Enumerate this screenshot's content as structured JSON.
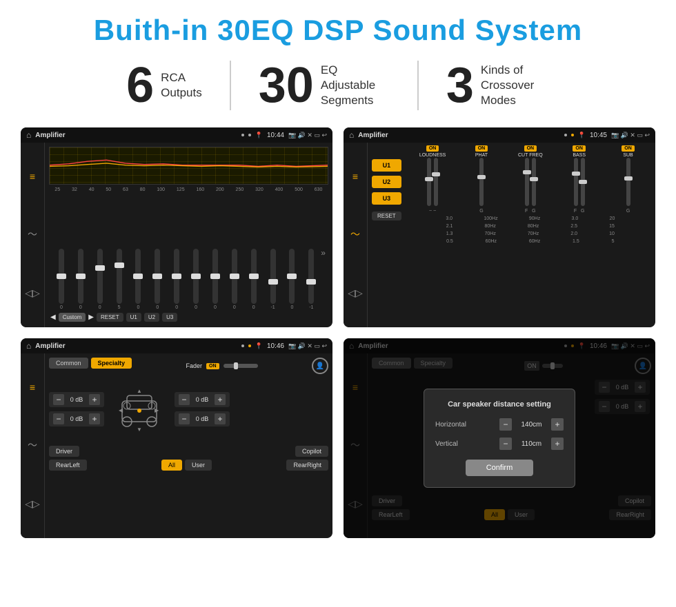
{
  "page": {
    "title": "Buith-in 30EQ DSP Sound System"
  },
  "stats": [
    {
      "number": "6",
      "label": "RCA\nOutputs"
    },
    {
      "number": "30",
      "label": "EQ Adjustable\nSegments"
    },
    {
      "number": "3",
      "label": "Kinds of\nCrossover Modes"
    }
  ],
  "screens": [
    {
      "id": "screen1",
      "title": "Amplifier",
      "time": "10:44",
      "freq_labels": [
        "25",
        "32",
        "40",
        "50",
        "63",
        "80",
        "100",
        "125",
        "160",
        "200",
        "250",
        "320",
        "400",
        "500",
        "630"
      ],
      "slider_values": [
        "0",
        "0",
        "0",
        "5",
        "0",
        "0",
        "0",
        "0",
        "0",
        "0",
        "0",
        "-1",
        "0",
        "-1"
      ],
      "bottom_btns": [
        "Custom",
        "RESET",
        "U1",
        "U2",
        "U3"
      ]
    },
    {
      "id": "screen2",
      "title": "Amplifier",
      "time": "10:45",
      "u_buttons": [
        "U1",
        "U2",
        "U3"
      ],
      "controls": [
        {
          "label": "LOUDNESS",
          "on": true
        },
        {
          "label": "PHAT",
          "on": true
        },
        {
          "label": "CUT FREQ",
          "on": true
        },
        {
          "label": "BASS",
          "on": true
        },
        {
          "label": "SUB",
          "on": true
        }
      ],
      "reset_label": "RESET"
    },
    {
      "id": "screen3",
      "title": "Amplifier",
      "time": "10:46",
      "tabs": [
        "Common",
        "Specialty"
      ],
      "fader_label": "Fader",
      "fader_on": "ON",
      "db_values": [
        "0 dB",
        "0 dB",
        "0 dB",
        "0 dB"
      ],
      "bottom_btns": [
        "Driver",
        "Copilot",
        "RearLeft",
        "All",
        "User",
        "RearRight"
      ]
    },
    {
      "id": "screen4",
      "title": "Amplifier",
      "time": "10:46",
      "tabs": [
        "Common",
        "Specialty"
      ],
      "modal": {
        "title": "Car speaker distance setting",
        "rows": [
          {
            "label": "Horizontal",
            "value": "140cm"
          },
          {
            "label": "Vertical",
            "value": "110cm"
          }
        ],
        "confirm_label": "Confirm"
      },
      "bottom_btns": [
        "Driver",
        "Copilot",
        "RearLeft",
        "All",
        "User",
        "RearRight"
      ]
    }
  ]
}
